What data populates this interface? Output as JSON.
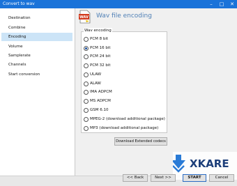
{
  "window": {
    "title": "Convert to wav",
    "min_glyph": "–",
    "max_glyph": "□",
    "close_glyph": "✕"
  },
  "sidebar": {
    "items": [
      {
        "label": "Destination"
      },
      {
        "label": "Combine"
      },
      {
        "label": "Encoding"
      },
      {
        "label": "Volume"
      },
      {
        "label": "Samplerate"
      },
      {
        "label": "Channels"
      },
      {
        "label": "Start conversion"
      }
    ],
    "active_index": 2
  },
  "header": {
    "title": "Wav file encoding",
    "icon": "wav-file-icon",
    "icon_text": "WAV"
  },
  "encoding": {
    "group_label": "Wav encoding",
    "options": [
      {
        "label": "PCM 8 bit",
        "checked": false
      },
      {
        "label": "PCM 16 bit",
        "checked": true
      },
      {
        "label": "PCM 24 bit",
        "checked": false
      },
      {
        "label": "PCM 32 bit",
        "checked": false
      },
      {
        "label": "ULAW",
        "checked": false
      },
      {
        "label": "ALAW",
        "checked": false
      },
      {
        "label": "IMA ADPCM",
        "checked": false
      },
      {
        "label": "MS ADPCM",
        "checked": false
      },
      {
        "label": "GSM 6.10",
        "checked": false
      },
      {
        "label": "MPEG-2 (download additional package)",
        "checked": false
      },
      {
        "label": "MP3 (download additional package)",
        "checked": false
      }
    ],
    "download_button": "Download Extended codecs"
  },
  "footer": {
    "back": "<< Back",
    "next": "Next >>",
    "start": "START",
    "cancel": "Cancel"
  },
  "watermark": {
    "text": "XKARE"
  },
  "colors": {
    "accent": "#1a73d9",
    "header_text": "#4e7fb5",
    "active_item": "#cce4f7"
  }
}
